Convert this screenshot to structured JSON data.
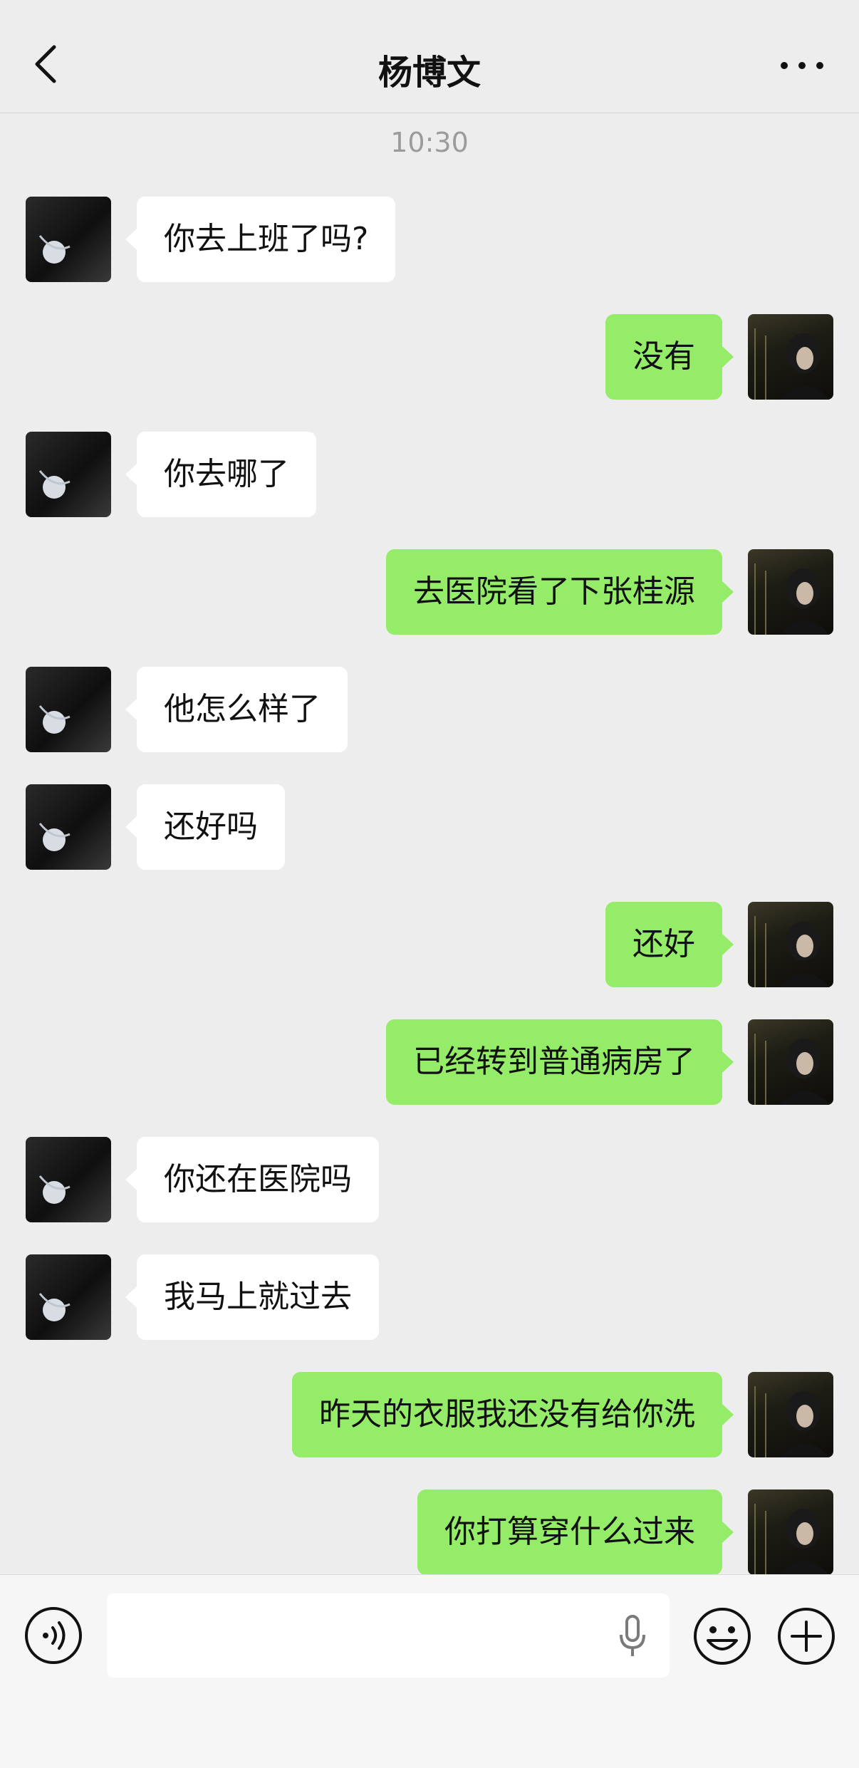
{
  "header": {
    "title": "杨博文"
  },
  "chat": {
    "timestamp": "10:30",
    "messages": [
      {
        "side": "in",
        "text": "你去上班了吗?"
      },
      {
        "side": "out",
        "text": "没有"
      },
      {
        "side": "in",
        "text": "你去哪了"
      },
      {
        "side": "out",
        "text": "去医院看了下张桂源"
      },
      {
        "side": "in",
        "text": "他怎么样了"
      },
      {
        "side": "in",
        "text": "还好吗"
      },
      {
        "side": "out",
        "text": "还好"
      },
      {
        "side": "out",
        "text": "已经转到普通病房了"
      },
      {
        "side": "in",
        "text": "你还在医院吗"
      },
      {
        "side": "in",
        "text": "我马上就过去"
      },
      {
        "side": "out",
        "text": "昨天的衣服我还没有给你洗"
      },
      {
        "side": "out",
        "text": "你打算穿什么过来"
      }
    ]
  },
  "input_bar": {
    "text_value": "",
    "icons": [
      "voice-icon",
      "microphone-icon",
      "emoji-icon",
      "plus-icon"
    ]
  },
  "colors": {
    "background": "#ededed",
    "outgoing_bubble": "#95ec69",
    "incoming_bubble": "#ffffff",
    "timestamp": "#9b9b9b"
  }
}
